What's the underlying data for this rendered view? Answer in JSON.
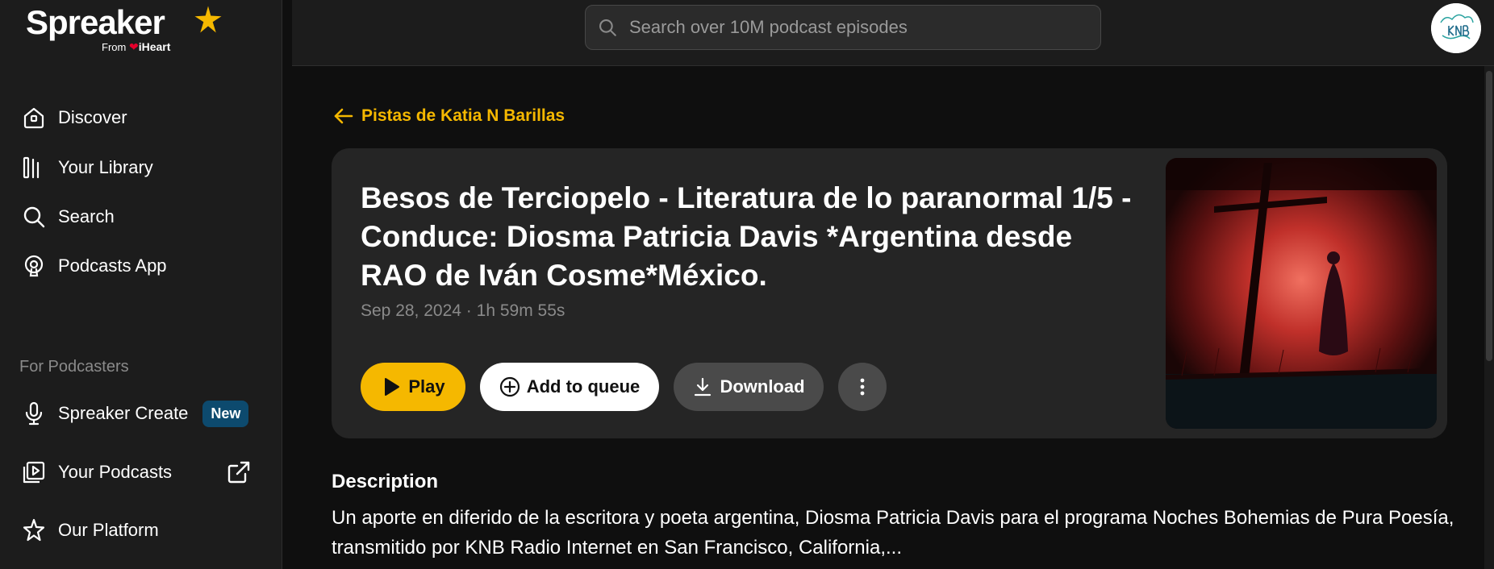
{
  "brand": {
    "name": "Spreaker",
    "from_label": "From",
    "partner": "iHeart"
  },
  "sidebar": {
    "items": [
      {
        "label": "Discover",
        "icon": "home-icon"
      },
      {
        "label": "Your Library",
        "icon": "library-icon"
      },
      {
        "label": "Search",
        "icon": "search-icon"
      },
      {
        "label": "Podcasts App",
        "icon": "podcast-app-icon"
      }
    ],
    "section_label": "For Podcasters",
    "podcaster_items": [
      {
        "label": "Spreaker Create",
        "icon": "microphone-icon",
        "badge": "New"
      },
      {
        "label": "Your Podcasts",
        "icon": "play-box-icon",
        "external": true
      },
      {
        "label": "Our Platform",
        "icon": "star-outline-icon"
      }
    ]
  },
  "search": {
    "placeholder": "Search over 10M podcast episodes",
    "value": ""
  },
  "back_link": "Pistas de Katia N Barillas",
  "episode": {
    "title": "Besos de Terciopelo - Literatura de lo paranormal 1/5 - Conduce: Diosma Patricia Davis *Argentina desde RAO de Iván Cosme*México.",
    "date": "Sep 28, 2024",
    "separator": "·",
    "duration": "1h 59m 55s"
  },
  "actions": {
    "play": "Play",
    "queue": "Add to queue",
    "download": "Download"
  },
  "description": {
    "heading": "Description",
    "text": "Un aporte en diferido de la escritora y poeta argentina, Diosma Patricia Davis para el programa Noches Bohemias de Pura Poesía, transmitido por KNB Radio Internet en San Francisco, California,..."
  },
  "colors": {
    "accent": "#f5b800",
    "background": "#0f0f0f",
    "sidebar": "#1c1c1c",
    "card": "#252525",
    "badge": "#0d4a6e"
  }
}
